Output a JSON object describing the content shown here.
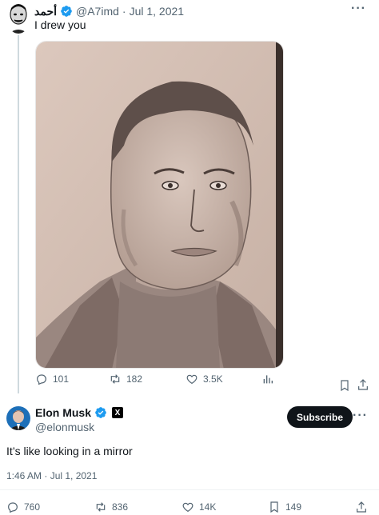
{
  "parent_tweet": {
    "author_name": "أحمد",
    "handle": "@A7imd",
    "separator": "·",
    "date": "Jul 1, 2021",
    "text": "I drew you",
    "media_description_icon": "pencil-sketch-portrait",
    "stats": {
      "replies": "101",
      "retweets": "182",
      "likes": "3.5K"
    }
  },
  "main_tweet": {
    "author_name": "Elon Musk",
    "handle": "@elonmusk",
    "badge_letter": "X",
    "subscribe_label": "Subscribe",
    "text": "It’s like looking in a mirror",
    "timestamp": "1:46 AM · Jul 1, 2021",
    "stats": {
      "replies": "760",
      "retweets": "836",
      "likes": "14K",
      "bookmarks": "149"
    }
  },
  "colors": {
    "verified_blue": "#1d9bf0",
    "text_primary": "#0f1419",
    "text_muted": "#536471",
    "thread_line": "#cfd9de",
    "subscribe_bg": "#0f1419"
  },
  "icons": [
    "more-icon",
    "verified-icon",
    "reply-icon",
    "retweet-icon",
    "like-icon",
    "views-icon",
    "bookmark-icon",
    "share-icon"
  ]
}
